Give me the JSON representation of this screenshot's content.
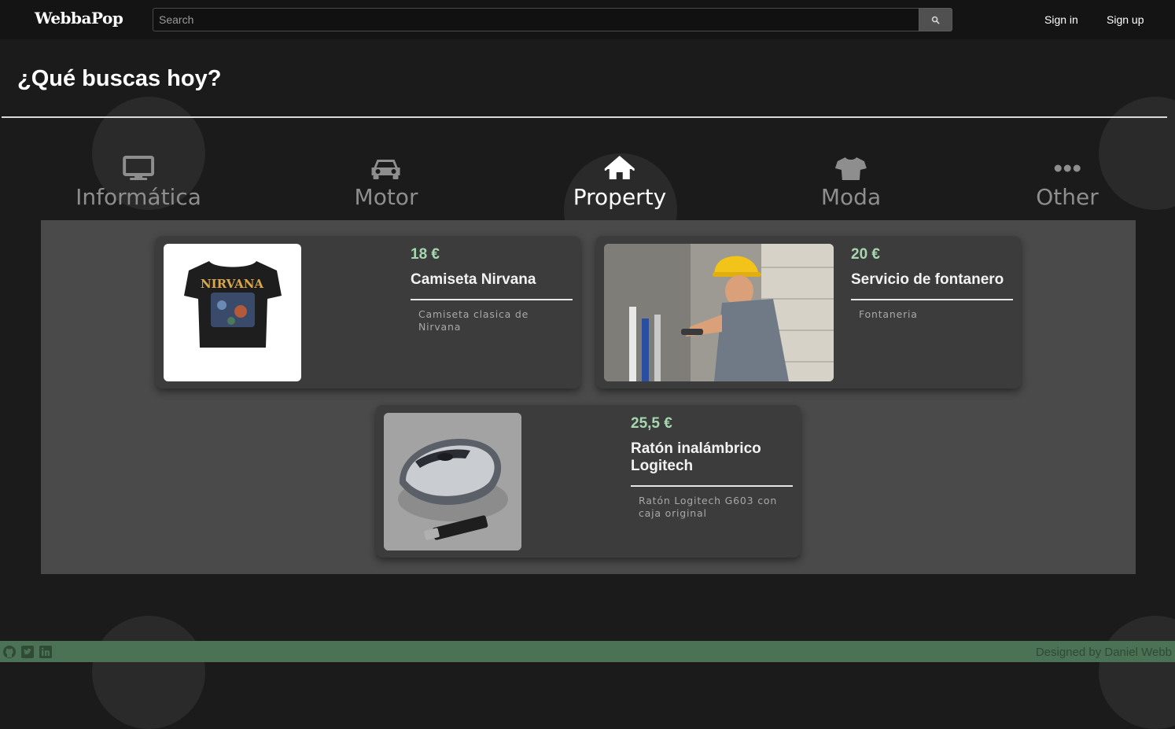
{
  "navbar": {
    "brand": "WebbaPop",
    "search_placeholder": "Search",
    "search_icon": "search-icon",
    "sign_in": "Sign in",
    "sign_up": "Sign up"
  },
  "page": {
    "heading": "¿Qué buscas hoy?"
  },
  "categories": [
    {
      "label": "Informática",
      "icon": "monitor-icon",
      "active": false
    },
    {
      "label": "Motor",
      "icon": "car-icon",
      "active": false
    },
    {
      "label": "Property",
      "icon": "home-icon",
      "active": true
    },
    {
      "label": "Moda",
      "icon": "tshirt-icon",
      "active": false
    },
    {
      "label": "Other",
      "icon": "ellipsis-icon",
      "active": false
    }
  ],
  "listings": [
    {
      "price": "18 €",
      "title": "Camiseta Nirvana",
      "description": "Camiseta clasica de Nirvana",
      "image": "nirvana-tshirt-image"
    },
    {
      "price": "20 €",
      "title": "Servicio de fontanero",
      "description": "Fontaneria",
      "image": "plumber-image"
    },
    {
      "price": "25,5 €",
      "title": "Ratón inalámbrico Logitech",
      "description": "Ratón Logitech G603 con caja original",
      "image": "wireless-mouse-image"
    }
  ],
  "footer": {
    "icons": [
      "github-icon",
      "twitter-icon",
      "linkedin-icon"
    ],
    "credit": "Designed by Daniel Webb"
  },
  "colors": {
    "background": "#1b1b1b",
    "navbar": "#141414",
    "panel": "#4a4a4a",
    "card": "#3c3c3c",
    "price": "#a6d8b0",
    "footer": "#4b7254"
  }
}
